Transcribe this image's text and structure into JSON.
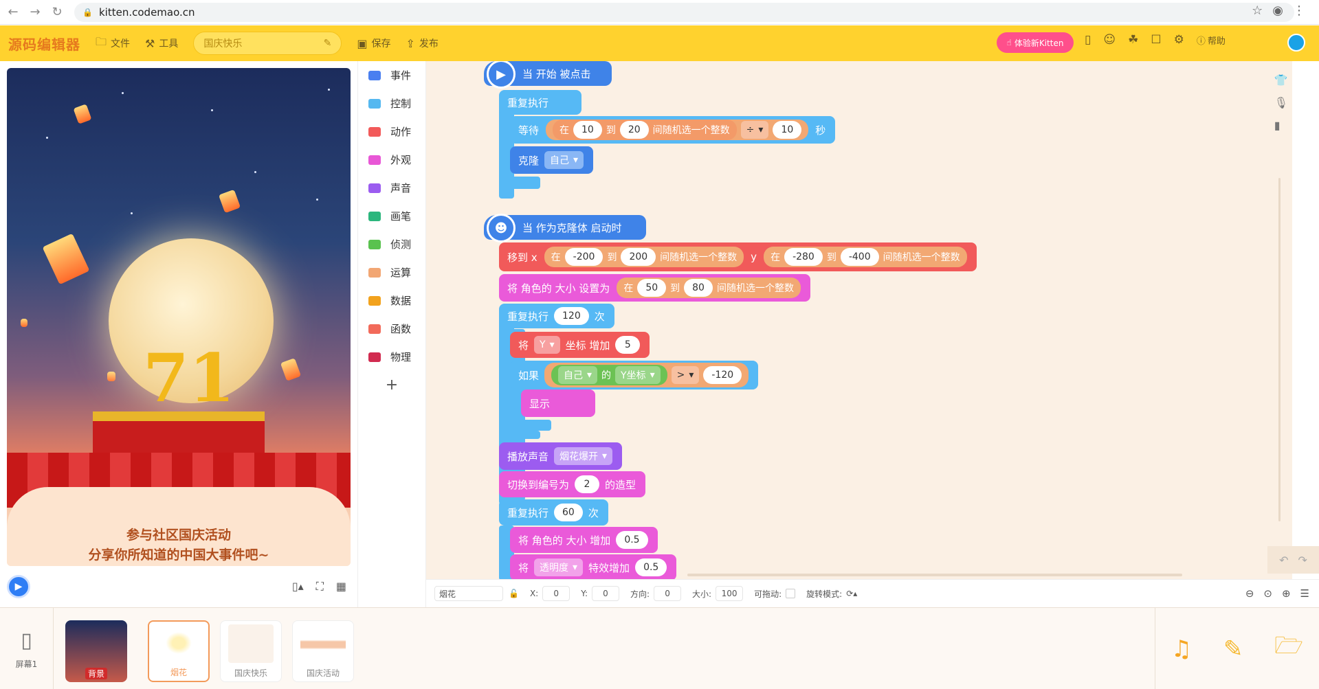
{
  "browser": {
    "url": "kitten.codemao.cn"
  },
  "header": {
    "brand": "源码编辑器",
    "file_label": "文件",
    "tools_label": "工具",
    "project_name": "国庆快乐",
    "save_label": "保存",
    "publish_label": "发布",
    "try_kitten_label": "体验新Kitten",
    "help_label": "帮助"
  },
  "stage": {
    "caption_1": "参与社区国庆活动",
    "caption_2": "分享你所知道的中国大事件吧~",
    "big_number": "71"
  },
  "categories": [
    {
      "label": "事件",
      "color": "#4a7ff0"
    },
    {
      "label": "控制",
      "color": "#55b8f0"
    },
    {
      "label": "动作",
      "color": "#f25a5a"
    },
    {
      "label": "外观",
      "color": "#e857d6"
    },
    {
      "label": "声音",
      "color": "#9b5cf0"
    },
    {
      "label": "画笔",
      "color": "#2cb67d"
    },
    {
      "label": "侦测",
      "color": "#5ac24f"
    },
    {
      "label": "运算",
      "color": "#f2a673"
    },
    {
      "label": "数据",
      "color": "#f2a21d"
    },
    {
      "label": "函数",
      "color": "#f26a5a"
    },
    {
      "label": "物理",
      "color": "#d12b50"
    }
  ],
  "add_category": "+",
  "script1": {
    "hat": "当 开始 被点击",
    "repeat": "重复执行",
    "wait": "等待",
    "in": "在",
    "min": "10",
    "to": "到",
    "max": "20",
    "random_int": "间随机选一个整数",
    "op_div": "÷",
    "divisor": "10",
    "sec": "秒",
    "clone": "克隆",
    "clone_target": "自己"
  },
  "script2": {
    "hat": "当 作为克隆体 启动时",
    "move_to_x": "移到 x",
    "in": "在",
    "x_min": "-200",
    "to": "到",
    "x_max": "200",
    "random_int": "间随机选一个整数",
    "y": "y",
    "y_min": "-280",
    "y_max": "-400",
    "set_size": "将 角色的 大小 设置为",
    "size_min": "50",
    "size_max": "80",
    "repeat_n": "重复执行",
    "repeat_count": "120",
    "times": "次",
    "jiang": "将",
    "coord_y": "Y",
    "coord_increase": "坐标 增加",
    "coord_step": "5",
    "if": "如果",
    "self": "自己",
    "of": "的",
    "y_coord": "Y坐标",
    "gt": ">",
    "threshold": "-120",
    "show": "显示",
    "play_sound": "播放声音",
    "sound_name": "烟花爆开",
    "switch_costume": "切换到编号为",
    "costume_no": "2",
    "costume_suffix": "的造型",
    "repeat_count2": "60",
    "size_increase": "将 角色的 大小 增加",
    "size_step": "0.5",
    "alpha": "透明度",
    "effect_increase": "特效增加",
    "alpha_step": "0.5"
  },
  "props": {
    "sprite_name": "烟花",
    "x_label": "X:",
    "x_value": "0",
    "y_label": "Y:",
    "y_value": "0",
    "dir_label": "方向:",
    "dir_value": "0",
    "size_label": "大小:",
    "size_value": "100",
    "drag_label": "可拖动:",
    "rotate_label": "旋转模式:"
  },
  "bottom": {
    "screen_label": "屏幕1",
    "bg_label": "背景",
    "sprites": [
      "烟花",
      "国庆快乐",
      "国庆活动"
    ]
  }
}
